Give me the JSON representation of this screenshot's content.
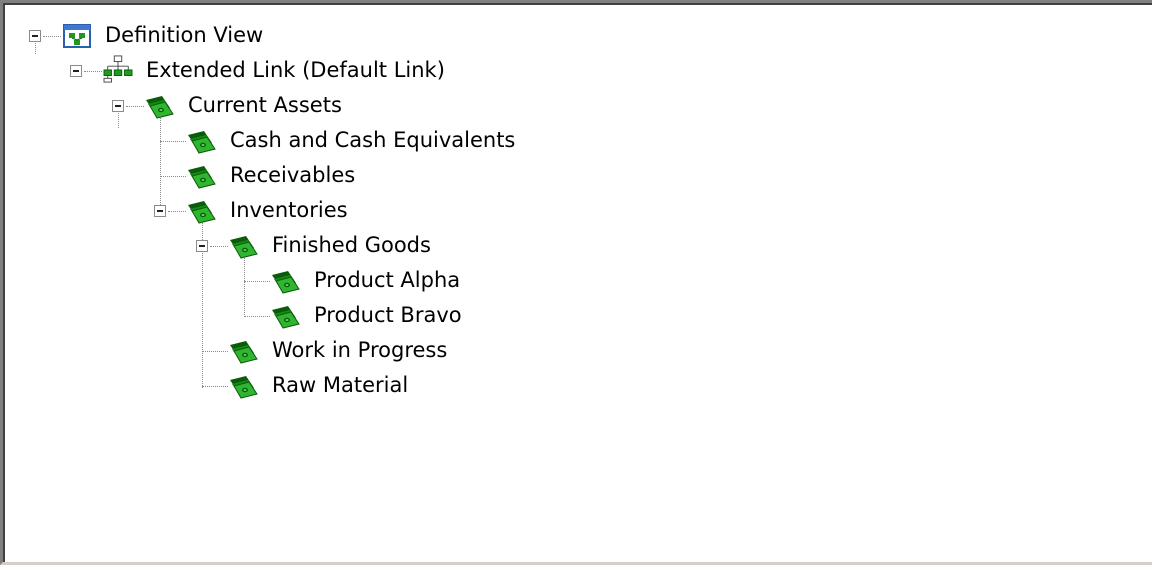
{
  "window": {
    "title": "Definition View"
  },
  "tree": {
    "root": {
      "label": "Definition View",
      "icon": "definition-view-icon",
      "expanded": true
    },
    "extended_link": {
      "label": "Extended Link (Default Link)",
      "icon": "link-network-icon",
      "expanded": true
    },
    "current_assets": {
      "label": "Current Assets",
      "icon": "money-icon",
      "expanded": true
    },
    "cash": {
      "label": "Cash and Cash Equivalents",
      "icon": "money-icon"
    },
    "receivables": {
      "label": "Receivables",
      "icon": "money-icon"
    },
    "inventories": {
      "label": "Inventories",
      "icon": "money-icon",
      "expanded": true
    },
    "finished_goods": {
      "label": "Finished Goods",
      "icon": "money-icon",
      "expanded": true
    },
    "product_alpha": {
      "label": "Product Alpha",
      "icon": "money-icon"
    },
    "product_bravo": {
      "label": "Product Bravo",
      "icon": "money-icon"
    },
    "work_in_progress": {
      "label": "Work in Progress",
      "icon": "money-icon"
    },
    "raw_material": {
      "label": "Raw Material",
      "icon": "money-icon"
    }
  },
  "colors": {
    "money": "#1e9b1e",
    "money_dark": "#0a5c0a",
    "window_bg": "#ffffff",
    "frame": "#808080"
  }
}
